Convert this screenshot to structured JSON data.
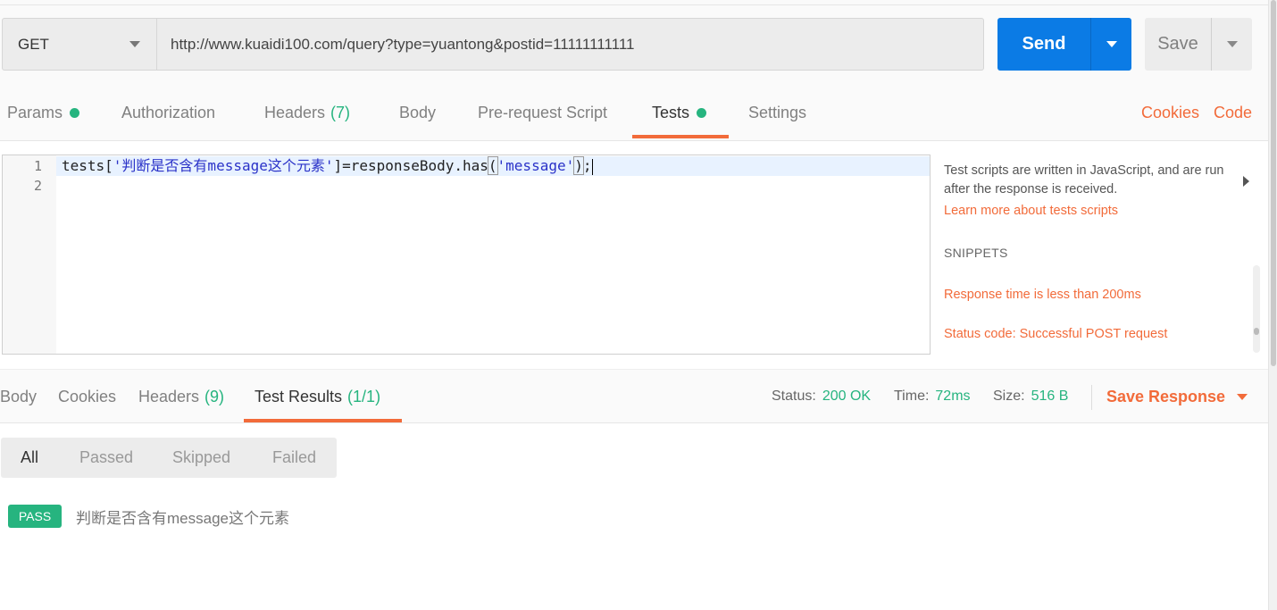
{
  "request": {
    "method": "GET",
    "url": "http://www.kuaidi100.com/query?type=yuantong&postid=11111111111",
    "send_label": "Send",
    "save_label": "Save"
  },
  "request_tabs": {
    "params": "Params",
    "authorization": "Authorization",
    "headers": "Headers",
    "headers_count": "(7)",
    "body": "Body",
    "prerequest": "Pre-request Script",
    "tests": "Tests",
    "settings": "Settings",
    "cookies": "Cookies",
    "code": "Code",
    "active": "Tests"
  },
  "editor": {
    "line_numbers": [
      "1",
      "2"
    ],
    "code_prefix": "tests[",
    "code_string1": "'判断是否含有message这个元素'",
    "code_middle": "]=responseBody.has",
    "code_open": "(",
    "code_string2": "'message'",
    "code_close": ")",
    "code_suffix": ";"
  },
  "snippets_panel": {
    "description": "Test scripts are written in JavaScript, and are run after the response is received.",
    "learn_more": "Learn more about tests scripts",
    "label": "SNIPPETS",
    "items": [
      "Response time is less than 200ms",
      "Status code: Successful POST request"
    ]
  },
  "response_tabs": {
    "body": "Body",
    "cookies": "Cookies",
    "headers": "Headers",
    "headers_count": "(9)",
    "test_results": "Test Results",
    "test_results_count": "(1/1)",
    "active": "Test Results"
  },
  "response_meta": {
    "status_label": "Status:",
    "status_value": "200 OK",
    "time_label": "Time:",
    "time_value": "72ms",
    "size_label": "Size:",
    "size_value": "516 B",
    "save_response": "Save Response"
  },
  "filters": {
    "all": "All",
    "passed": "Passed",
    "skipped": "Skipped",
    "failed": "Failed",
    "active": "All"
  },
  "results": [
    {
      "status": "PASS",
      "name": "判断是否含有message这个元素"
    }
  ],
  "colors": {
    "accent": "#f26b3a",
    "primary": "#0b7be5",
    "success": "#26b47f"
  }
}
